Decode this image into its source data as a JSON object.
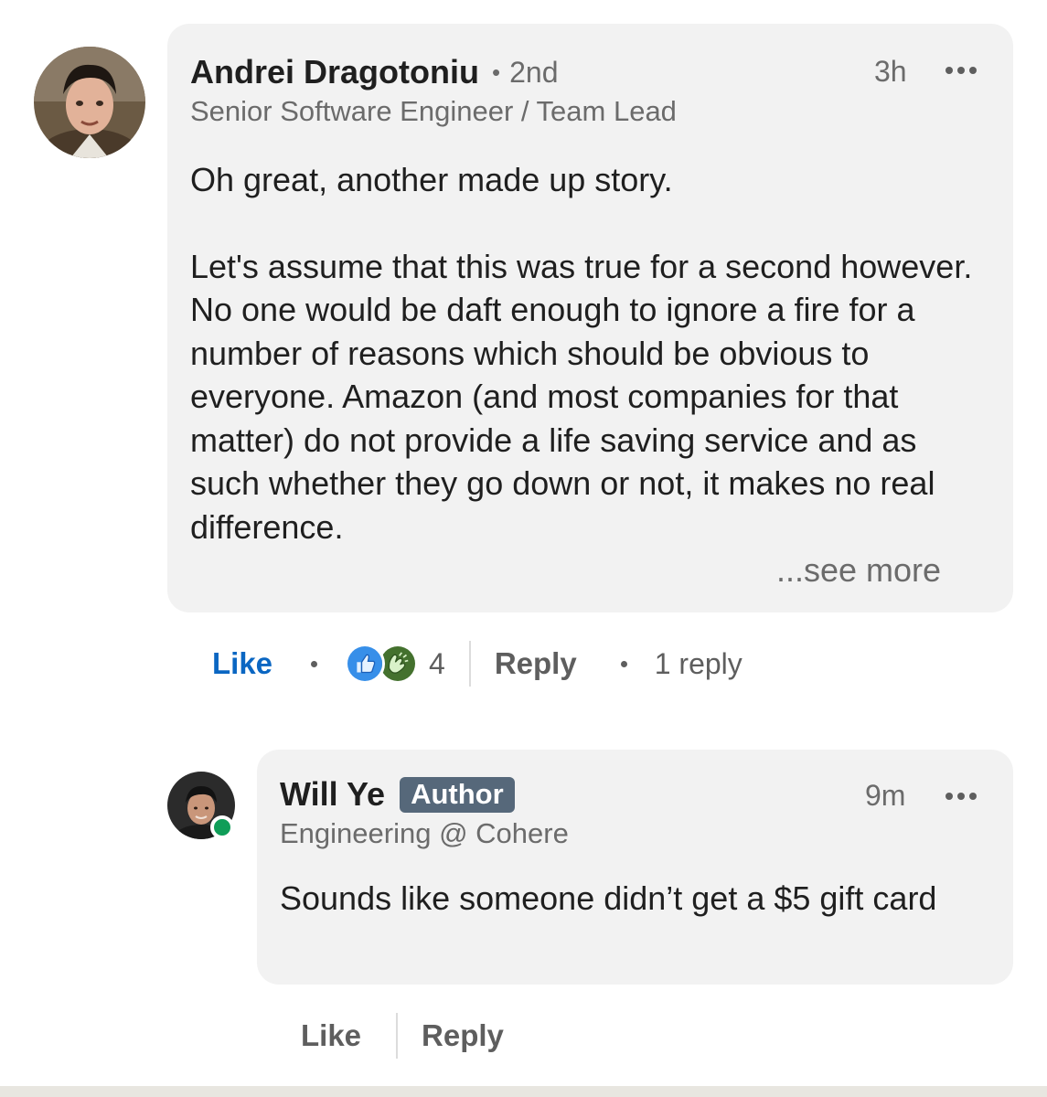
{
  "comment": {
    "author_name": "Andrei Dragotoniu",
    "connection_degree": "2nd",
    "headline": "Senior Software Engineer / Team Lead",
    "time": "3h",
    "body_paragraphs": [
      "Oh great, another made up story.",
      "Let's assume that this was true for a second however. No one would be daft enough to ignore a fire for a number of reasons which should be obvious to everyone. Amazon (and most companies for that matter) do not provide a life saving service and as such whether they go down or not, it makes no real difference."
    ],
    "see_more_label": "...see more",
    "actions": {
      "like_label": "Like",
      "reaction_icons": [
        "like-reaction-icon",
        "celebrate-reaction-icon"
      ],
      "reaction_count": "4",
      "reply_label": "Reply",
      "replies_label": "1 reply"
    }
  },
  "reply": {
    "author_name": "Will Ye",
    "badge": "Author",
    "headline": "Engineering @ Cohere",
    "time": "9m",
    "body": "Sounds like someone didn’t get a $5 gift card",
    "online": true,
    "actions": {
      "like_label": "Like",
      "reply_label": "Reply"
    }
  },
  "colors": {
    "bubble": "#f2f2f2",
    "link_blue": "#0a66c2",
    "muted_text": "#6b6b6b",
    "author_badge": "#56687a",
    "online_green": "#0f9d58"
  }
}
